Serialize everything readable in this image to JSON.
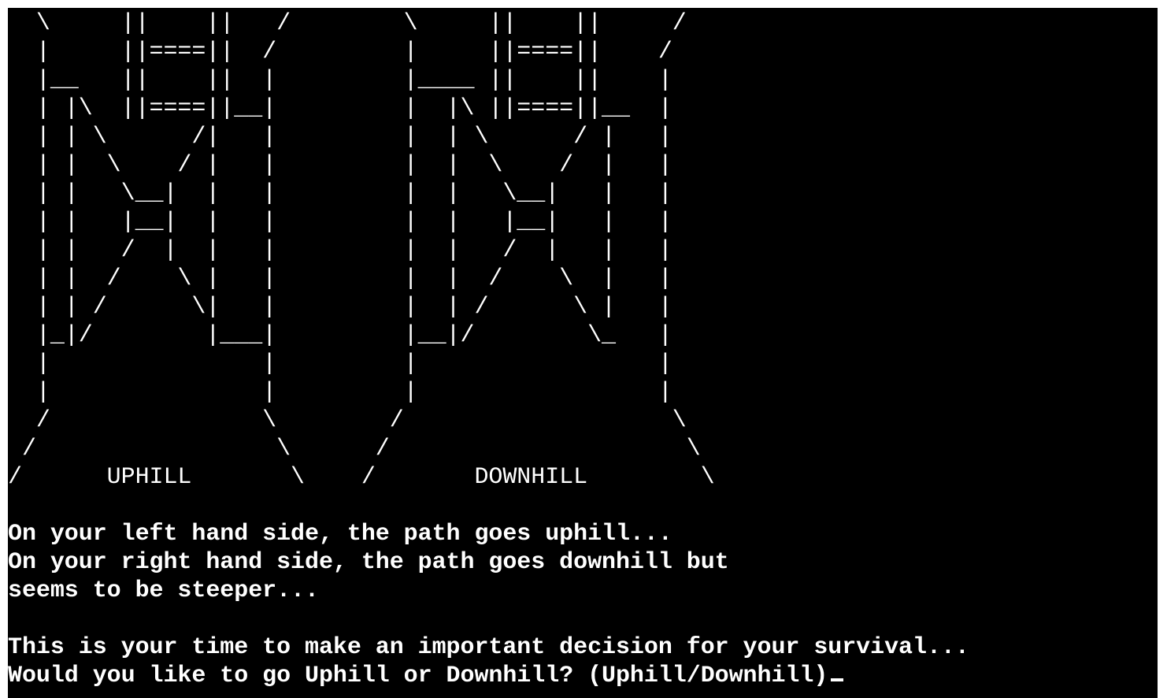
{
  "terminal": {
    "background": "#000000",
    "foreground": "#ffffff",
    "art_lines": [
      "  \\     ||    ||   /        \\     ||    ||     /",
      "  |     ||====||  /         |     ||====||    /",
      "  |__   ||    ||  |         |____ ||    ||    |",
      "  | |\\  ||====||__|         |  |\\ ||====||__  |",
      "  | | \\      /|   |         |  | \\      / |   |",
      "  | |  \\    / |   |         |  |  \\    /  |   |",
      "  | |   \\__|  |   |         |  |   \\__|   |   |",
      "  | |   |__|  |   |         |  |   |__|   |   |",
      "  | |   /  |  |   |         |  |   /  |   |   |",
      "  | |  /    \\ |   |         |  |  /    \\  |   |",
      "  | | /      \\|   |         |  | /      \\ |   |",
      "  |_|/        |___|         |__|/        \\_   |",
      "  |               |         |                 |",
      "  |               |         |                 |",
      "  /               \\        /                   \\",
      " /                 \\      /                     \\",
      "/      UPHILL       \\    /       DOWNHILL        \\"
    ],
    "messages": [
      "",
      "On your left hand side, the path goes uphill...",
      "On your right hand side, the path goes downhill but",
      "seems to be steeper...",
      "",
      "This is your time to make an important decision for your survival...",
      "Would you like to go Uphill or Downhill? (Uphill/Downhill)"
    ]
  }
}
